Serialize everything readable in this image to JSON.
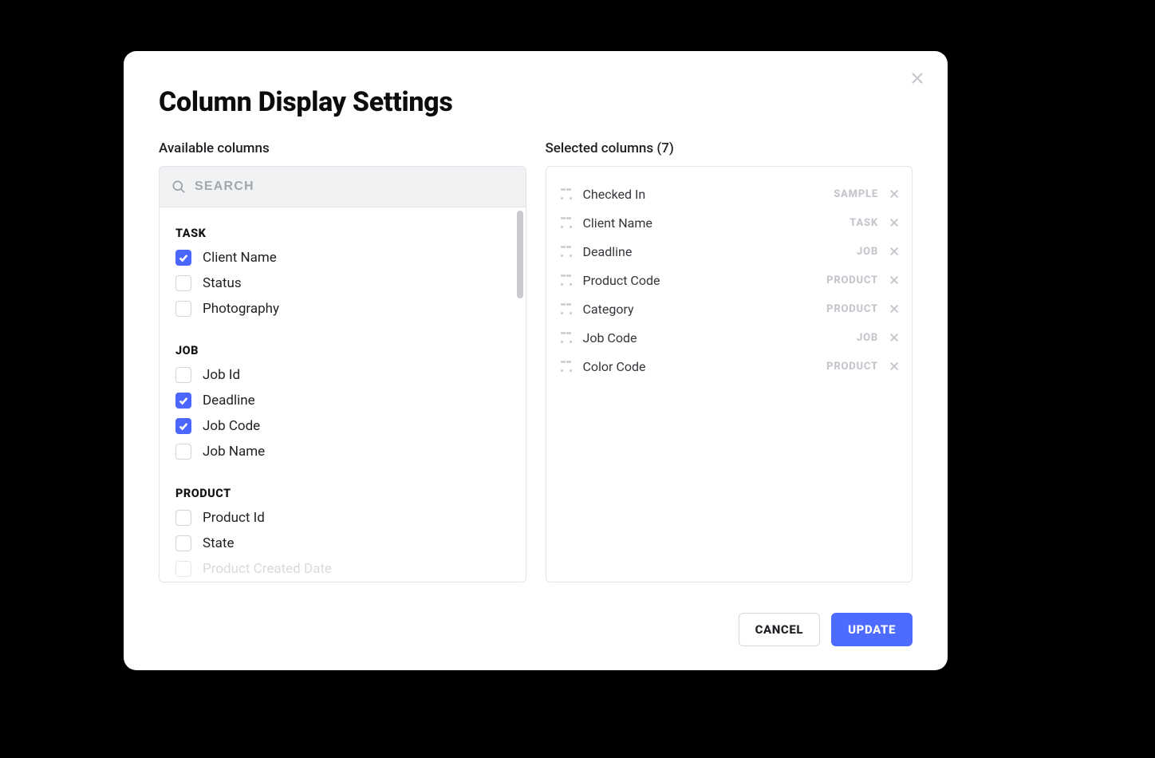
{
  "dialog": {
    "title": "Column Display Settings",
    "close_icon": "close-icon"
  },
  "available": {
    "label": "Available columns",
    "search_placeholder": "SEARCH",
    "groups": [
      {
        "name": "TASK",
        "items": [
          {
            "label": "Client Name",
            "checked": true
          },
          {
            "label": "Status",
            "checked": false
          },
          {
            "label": "Photography",
            "checked": false
          }
        ]
      },
      {
        "name": "JOB",
        "items": [
          {
            "label": "Job Id",
            "checked": false
          },
          {
            "label": "Deadline",
            "checked": true
          },
          {
            "label": "Job Code",
            "checked": true
          },
          {
            "label": "Job Name",
            "checked": false
          }
        ]
      },
      {
        "name": "PRODUCT",
        "items": [
          {
            "label": "Product Id",
            "checked": false
          },
          {
            "label": "State",
            "checked": false
          },
          {
            "label": "Product Created Date",
            "checked": false,
            "faded": true
          }
        ]
      }
    ]
  },
  "selected": {
    "label": "Selected columns (7)",
    "count": 7,
    "items": [
      {
        "label": "Checked In",
        "tag": "SAMPLE"
      },
      {
        "label": "Client Name",
        "tag": "TASK"
      },
      {
        "label": "Deadline",
        "tag": "JOB"
      },
      {
        "label": "Product Code",
        "tag": "PRODUCT"
      },
      {
        "label": "Category",
        "tag": "PRODUCT"
      },
      {
        "label": "Job Code",
        "tag": "JOB"
      },
      {
        "label": "Color Code",
        "tag": "PRODUCT"
      }
    ]
  },
  "buttons": {
    "cancel": "CANCEL",
    "update": "UPDATE"
  }
}
